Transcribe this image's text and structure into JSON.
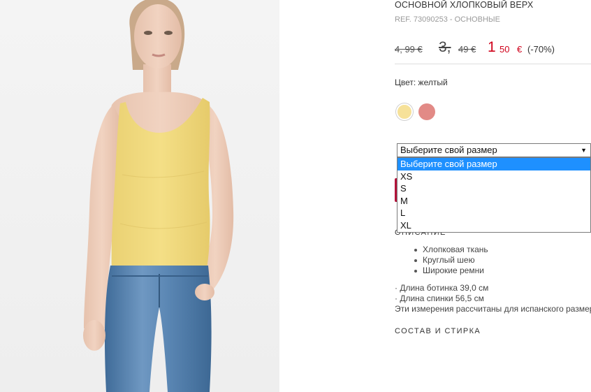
{
  "product": {
    "title": "ОСНОВНОЙ ХЛОПКОВЫЙ ВЕРХ",
    "ref": "REF. 73090253 - ОСНОВНЫЕ"
  },
  "price": {
    "original": "4, 99 €",
    "previous_int": "3,",
    "previous_dec": "49 €",
    "sale_int": "1",
    "sale_dec": "50",
    "sale_currency": "€",
    "discount": "(-70%)",
    "sale_color": "#d0021b"
  },
  "color": {
    "label": "Цвет: желтый",
    "swatches": [
      {
        "name": "yellow",
        "hex": "#f6e199",
        "selected": true
      },
      {
        "name": "coral",
        "hex": "#e28a86",
        "selected": false
      }
    ]
  },
  "size_select": {
    "value": "Выберите свой размер",
    "arrow": "▼",
    "options": [
      "Выберите свой размер",
      "XS",
      "S",
      "M",
      "L",
      "XL"
    ],
    "highlighted_index": 0
  },
  "description": {
    "heading": "ОПИСАНИЕ",
    "features": [
      "Хлопковая ткань",
      "Круглый шею",
      "Широкие ремни"
    ],
    "measures": [
      "· Длина ботинка 39,0 см",
      "· Длина спинки 56,5 см",
      "Эти измерения рассчитаны для испанского размера S"
    ]
  },
  "composition": {
    "heading": "СОСТАВ И СТИРКА"
  },
  "image": {
    "top_color": "#f2dc7e",
    "jeans_color": "#4f7cab"
  }
}
